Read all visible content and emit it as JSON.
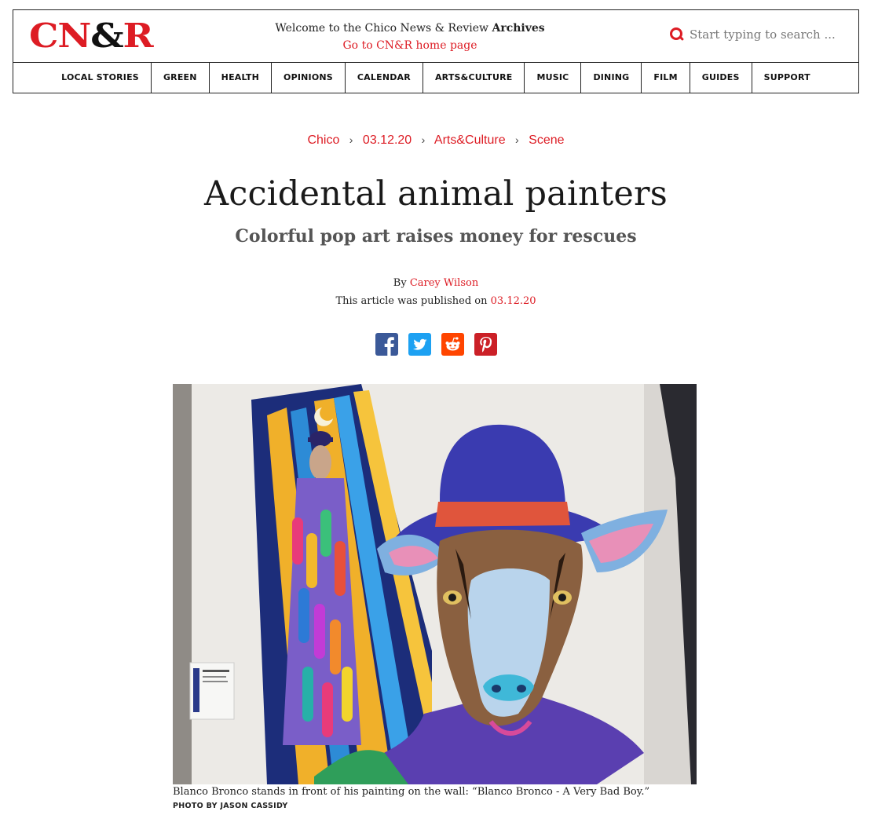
{
  "header": {
    "logo_text": "CN&R",
    "welcome_prefix": "Welcome to the Chico News & Review",
    "welcome_bold": "Archives",
    "home_link": "Go to CN&R home page",
    "search_placeholder": "Start typing to search ...",
    "search_icon": "search-icon",
    "accent_color": "#dd1c24"
  },
  "nav": {
    "items": [
      "LOCAL STORIES",
      "GREEN",
      "HEALTH",
      "OPINIONS",
      "CALENDAR",
      "ARTS&CULTURE",
      "MUSIC",
      "DINING",
      "FILM",
      "GUIDES",
      "SUPPORT"
    ]
  },
  "breadcrumb": {
    "items": [
      "Chico",
      "03.12.20",
      "Arts&Culture",
      "Scene"
    ],
    "separator": "›"
  },
  "article": {
    "title": "Accidental animal painters",
    "subtitle": "Colorful pop art raises money for rescues",
    "by_prefix": "By",
    "author": "Carey Wilson",
    "published_prefix": "This article was published on",
    "published_date": "03.12.20"
  },
  "share": {
    "icons": [
      "facebook-icon",
      "twitter-icon",
      "reddit-icon",
      "pinterest-icon"
    ],
    "colors": {
      "facebook": "#3b5998",
      "twitter": "#1da1f2",
      "reddit": "#ff4500",
      "pinterest": "#cb2027"
    }
  },
  "figure": {
    "caption": "Blanco Bronco stands in front of his painting on the wall: “Blanco Bronco - A Very Bad Boy.”",
    "credit": "PHOTO BY JASON CASSIDY"
  }
}
